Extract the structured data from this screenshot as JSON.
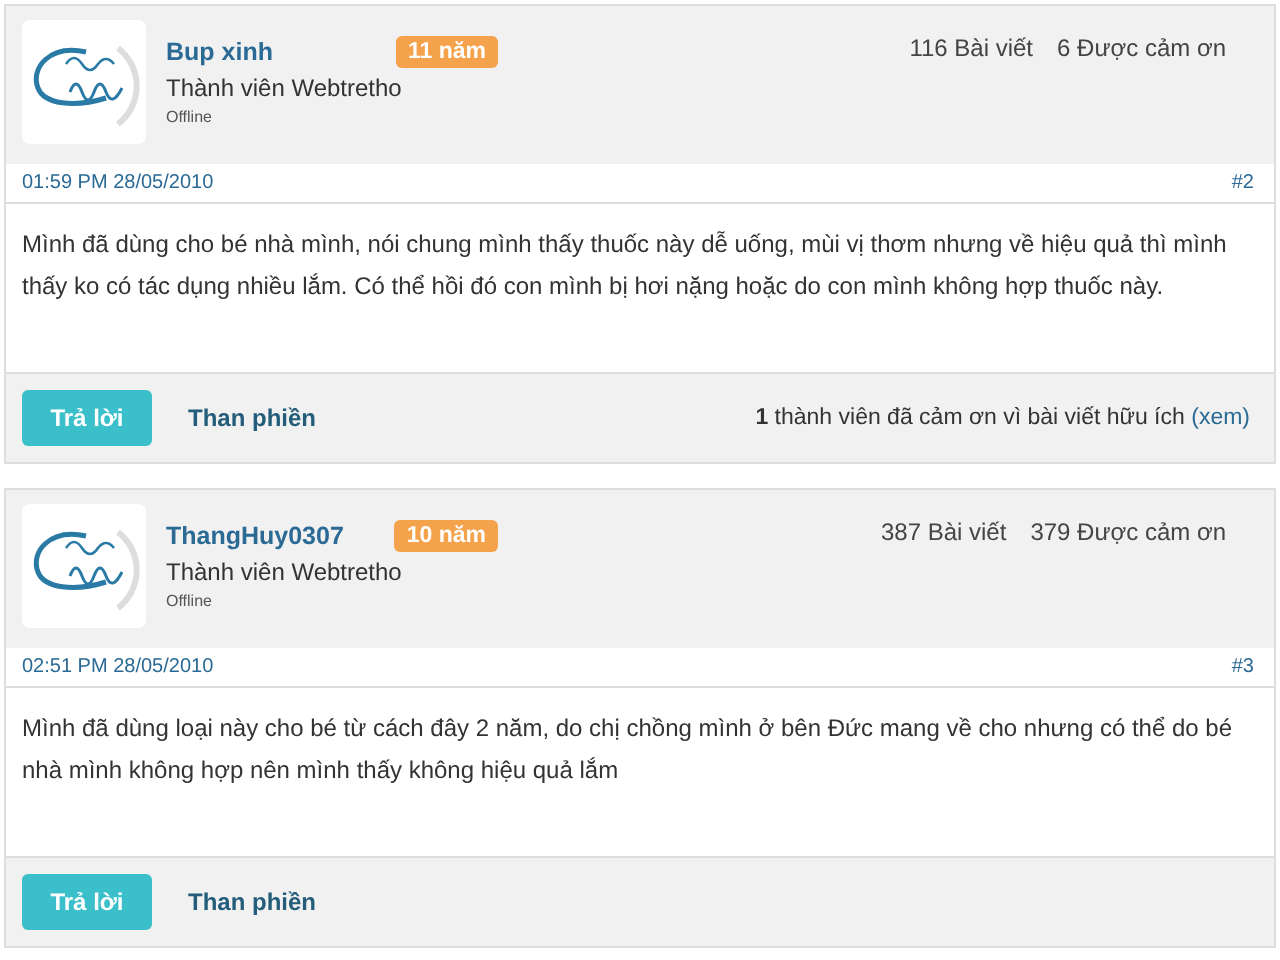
{
  "posts": [
    {
      "username": "Bup xinh",
      "badge": "11 năm",
      "role": "Thành viên Webtretho",
      "status": "Offline",
      "posts_count": "116 Bài viết",
      "thanks_count": "6 Được cảm ơn",
      "timestamp": "01:59 PM 28/05/2010",
      "post_number": "#2",
      "body": "Mình đã dùng cho bé nhà mình, nói chung mình thấy thuốc này dễ uống, mùi vị thơm nhưng về hiệu quả thì mình thấy ko có tác dụng nhiều lắm. Có thể hồi đó con mình bị hơi nặng hoặc do con mình không hợp thuốc này.",
      "reply_button": "Trả lời",
      "report_link": "Than phiền",
      "thanks_note": {
        "count": "1",
        "text": "thành viên đã cảm ơn vì bài viết hữu ích",
        "link": "(xem)"
      }
    },
    {
      "username": "ThangHuy0307",
      "badge": "10 năm",
      "role": "Thành viên Webtretho",
      "status": "Offline",
      "posts_count": "387 Bài viết",
      "thanks_count": "379 Được cảm ơn",
      "timestamp": "02:51 PM 28/05/2010",
      "post_number": "#3",
      "body": "Mình đã dùng loại này cho bé từ cách đây 2 năm, do chị chồng mình ở bên Đức mang về cho nhưng có thể do bé nhà mình không hợp nên mình thấy không hiệu quả lắm",
      "reply_button": "Trả lời",
      "report_link": "Than phiền"
    }
  ]
}
